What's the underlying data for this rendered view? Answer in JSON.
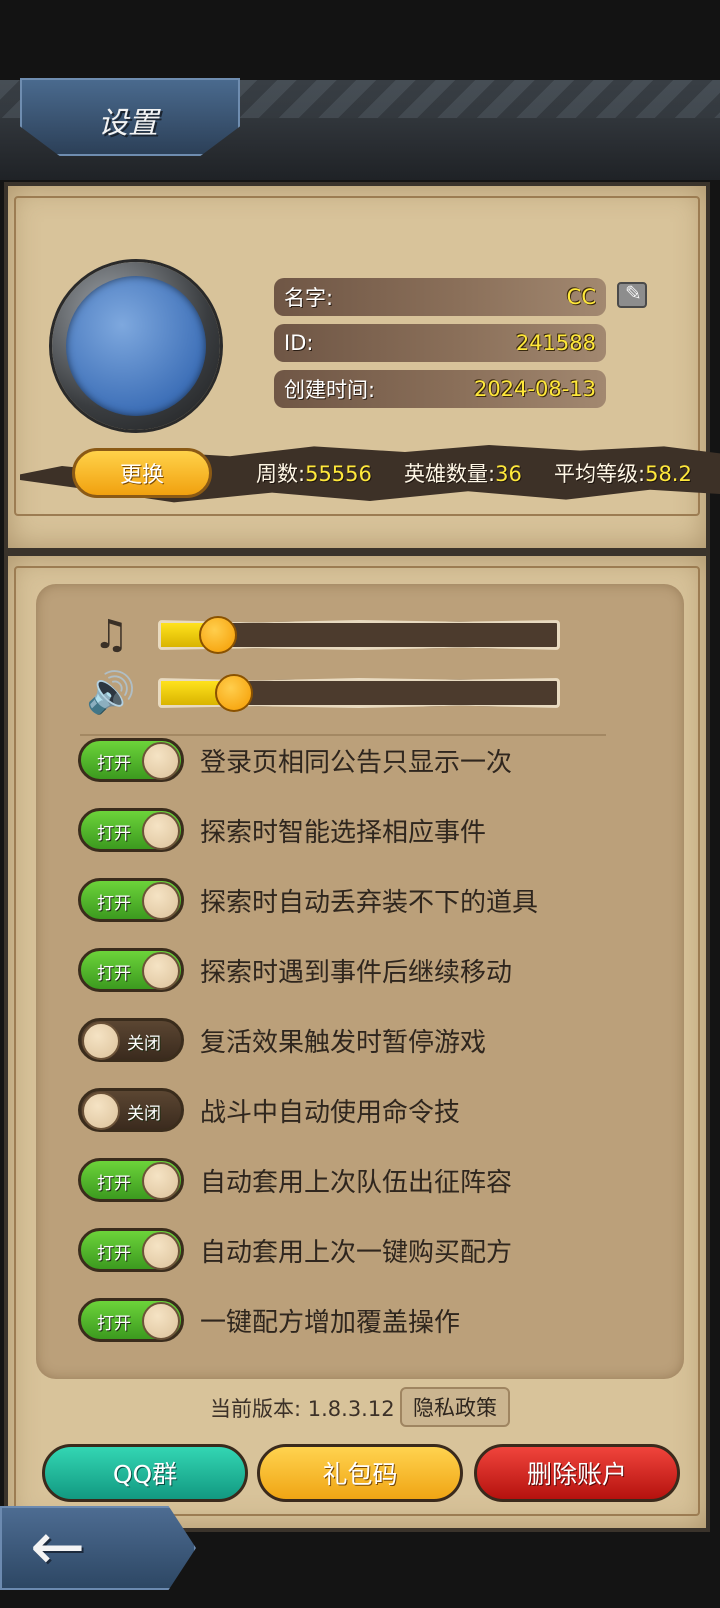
{
  "header": {
    "title": "设置"
  },
  "profile": {
    "name_label": "名字:",
    "name_value": "CC",
    "id_label": "ID:",
    "id_value": "241588",
    "created_label": "创建时间:",
    "created_value": "2024-08-13",
    "change_button": "更换"
  },
  "stats": {
    "weeks_label": "周数:",
    "weeks_value": "55556",
    "heroes_label": "英雄数量:",
    "heroes_value": "36",
    "avg_level_label": "平均等级:",
    "avg_level_value": "58.2"
  },
  "audio": {
    "music_icon": "music-note-icon",
    "music_level_fraction": 0.15,
    "sound_icon": "speaker-icon",
    "sound_level_fraction": 0.19
  },
  "toggles": [
    {
      "state": "打开",
      "on": true,
      "label": "登录页相同公告只显示一次"
    },
    {
      "state": "打开",
      "on": true,
      "label": "探索时智能选择相应事件"
    },
    {
      "state": "打开",
      "on": true,
      "label": "探索时自动丢弃装不下的道具"
    },
    {
      "state": "打开",
      "on": true,
      "label": "探索时遇到事件后继续移动"
    },
    {
      "state": "关闭",
      "on": false,
      "label": "复活效果触发时暂停游戏"
    },
    {
      "state": "关闭",
      "on": false,
      "label": "战斗中自动使用命令技"
    },
    {
      "state": "打开",
      "on": true,
      "label": "自动套用上次队伍出征阵容"
    },
    {
      "state": "打开",
      "on": true,
      "label": "自动套用上次一键购买配方"
    },
    {
      "state": "打开",
      "on": true,
      "label": "一键配方增加覆盖操作"
    }
  ],
  "footer": {
    "version": "当前版本: 1.8.3.12",
    "privacy": "隐私政策",
    "qq_group": "QQ群",
    "gift_code": "礼包码",
    "delete_account": "删除账户",
    "back": "←"
  },
  "colors": {
    "toggle_on": "#4cb52a",
    "toggle_off": "#4a3726",
    "accent_yellow": "#ffe83b"
  }
}
